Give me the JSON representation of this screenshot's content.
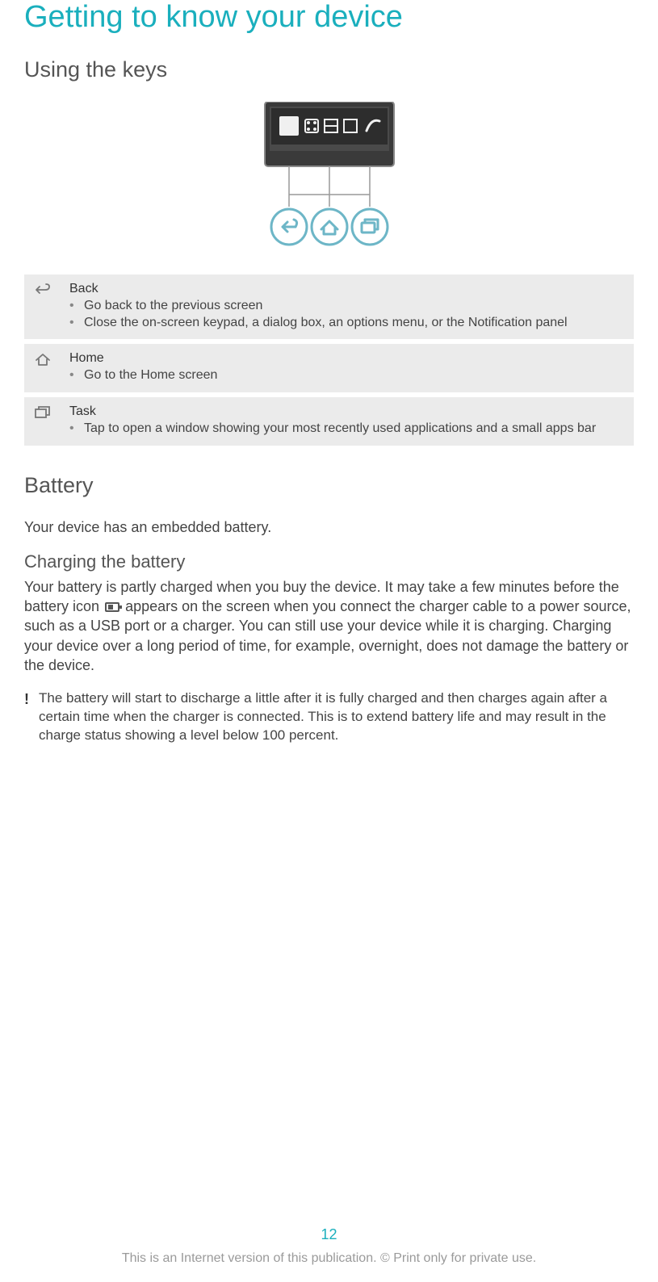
{
  "title": "Getting to know your device",
  "section_keys": "Using the keys",
  "keys": [
    {
      "name": "Back",
      "bullets": [
        "Go back to the previous screen",
        "Close the on-screen keypad, a dialog box, an options menu, or the Notification panel"
      ]
    },
    {
      "name": "Home",
      "bullets": [
        "Go to the Home screen"
      ]
    },
    {
      "name": "Task",
      "bullets": [
        "Tap to open a window showing your most recently used applications and a small apps bar"
      ]
    }
  ],
  "battery_heading": "Battery",
  "battery_intro": "Your device has an embedded battery.",
  "charging_heading": "Charging the battery",
  "charging_text_a": "Your battery is partly charged when you buy the device. It may take a few minutes before the battery icon ",
  "charging_text_b": " appears on the screen when you connect the charger cable to a power source, such as a USB port or a charger. You can still use your device while it is charging. Charging your device over a long period of time, for example, overnight, does not damage the battery or the device.",
  "note_text": "The battery will start to discharge a little after it is fully charged and then charges again after a certain time when the charger is connected. This is to extend battery life and may result in the charge status showing a level below 100 percent.",
  "page_number": "12",
  "footer": "This is an Internet version of this publication. © Print only for private use."
}
